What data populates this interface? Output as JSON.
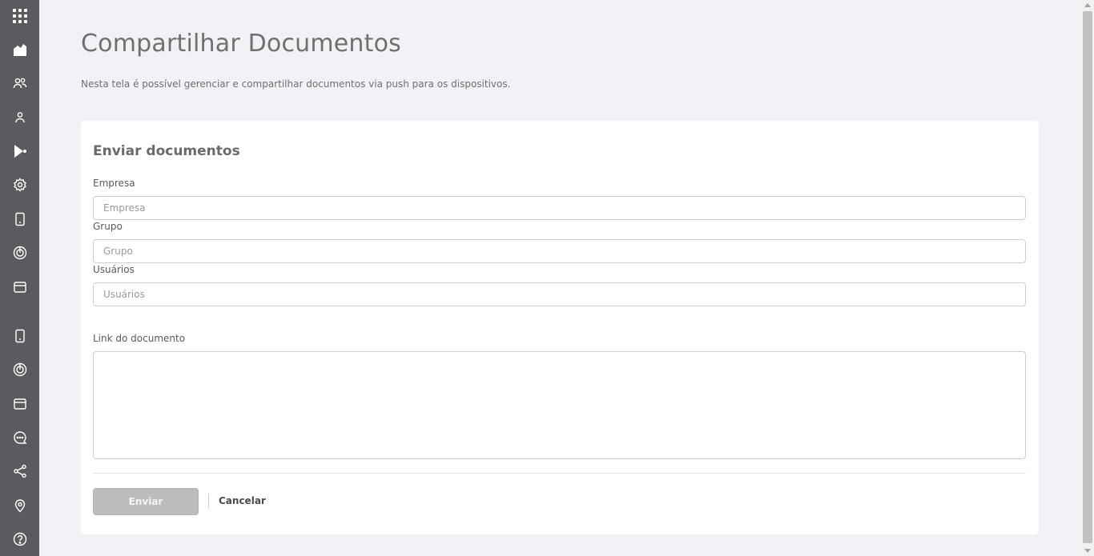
{
  "sidebar": {
    "items": [
      {
        "icon": "apps-grid-icon"
      },
      {
        "icon": "dashboard-icon"
      },
      {
        "icon": "groups-icon"
      },
      {
        "icon": "user-icon"
      },
      {
        "icon": "play-share-icon"
      },
      {
        "icon": "settings-icon"
      },
      {
        "icon": "device-icon"
      },
      {
        "icon": "radar-icon"
      },
      {
        "icon": "window-icon"
      },
      {
        "icon": "device-icon"
      },
      {
        "icon": "radar-icon"
      },
      {
        "icon": "window-icon"
      },
      {
        "icon": "chat-icon"
      },
      {
        "icon": "share-icon"
      },
      {
        "icon": "location-pin-icon"
      },
      {
        "icon": "help-icon"
      }
    ]
  },
  "page": {
    "title": "Compartilhar Documentos",
    "description": "Nesta tela é possível gerenciar e compartilhar documentos via push para os dispositivos."
  },
  "form": {
    "title": "Enviar documentos",
    "empresa": {
      "label": "Empresa",
      "placeholder": "Empresa",
      "value": ""
    },
    "grupo": {
      "label": "Grupo",
      "placeholder": "Grupo",
      "value": ""
    },
    "usuarios": {
      "label": "Usuários",
      "placeholder": "Usuários",
      "value": ""
    },
    "link": {
      "label": "Link do documento",
      "value": ""
    },
    "submit_label": "Enviar",
    "cancel_label": "Cancelar"
  },
  "colors": {
    "sidebar_bg": "#5b5b5f",
    "page_bg": "#f1f2f6",
    "card_bg": "#ffffff",
    "button_disabled": "#bdbdbd"
  }
}
